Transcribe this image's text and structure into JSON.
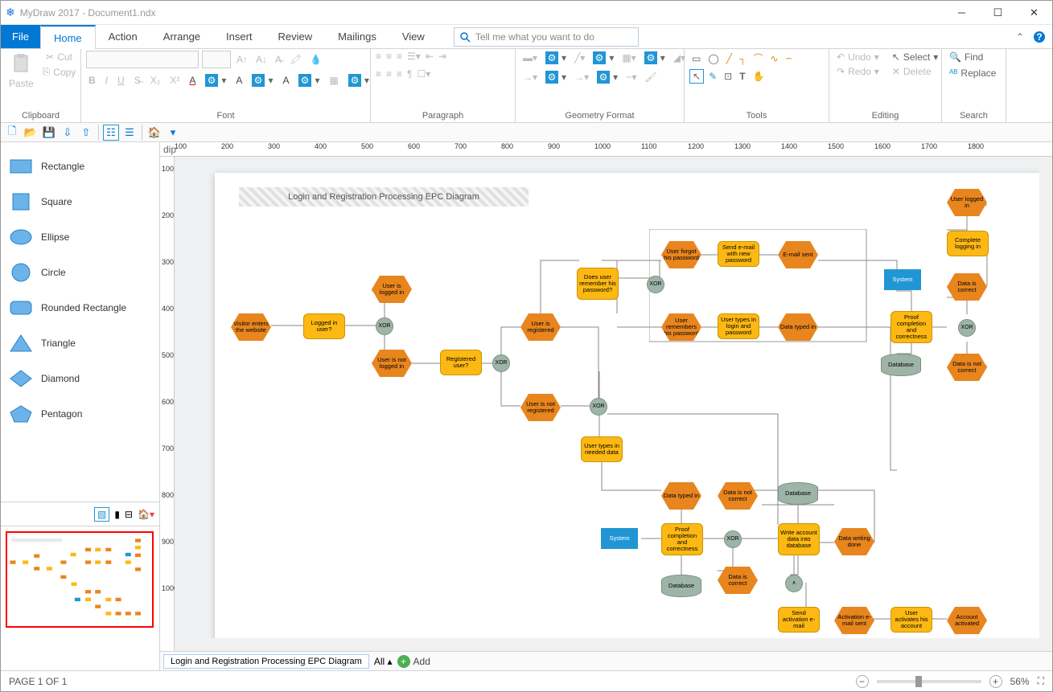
{
  "app": {
    "title": "MyDraw 2017 - Document1.ndx"
  },
  "tabs": {
    "file": "File",
    "home": "Home",
    "action": "Action",
    "arrange": "Arrange",
    "insert": "Insert",
    "review": "Review",
    "mailings": "Mailings",
    "view": "View"
  },
  "search": {
    "placeholder": "Tell me what you want to do"
  },
  "ribbon_groups": {
    "clipboard": "Clipboard",
    "font": "Font",
    "paragraph": "Paragraph",
    "geometry": "Geometry Format",
    "tools": "Tools",
    "editing": "Editing",
    "search": "Search"
  },
  "clipboard": {
    "paste": "Paste",
    "cut": "Cut",
    "copy": "Copy"
  },
  "editing": {
    "undo": "Undo",
    "redo": "Redo",
    "select": "Select",
    "delete": "Delete",
    "find": "Find",
    "replace": "Replace"
  },
  "shapes": {
    "rectangle": "Rectangle",
    "square": "Square",
    "ellipse": "Ellipse",
    "circle": "Circle",
    "rounded": "Rounded Rectangle",
    "triangle": "Triangle",
    "diamond": "Diamond",
    "pentagon": "Pentagon"
  },
  "ruler": {
    "unit": "dip",
    "hticks": [
      100,
      200,
      300,
      400,
      500,
      600,
      700,
      800,
      900,
      1000,
      1100,
      1200,
      1300,
      1400,
      1500,
      1600,
      1700,
      1800
    ],
    "vticks": [
      100,
      200,
      300,
      400,
      500,
      600,
      700,
      800,
      900,
      1000
    ]
  },
  "diagram": {
    "title": "Login and Registration Processing EPC Diagram"
  },
  "nodes": {
    "visitor": "Visitor enters the website",
    "logged_user": "Logged in user?",
    "user_logged": "User is logged in",
    "user_not_logged": "User is not logged in",
    "registered": "Registered user?",
    "user_registered": "User is registered",
    "user_not_registered": "User is not registered",
    "remember": "Does user remember his password?",
    "forgot": "User forgot his password",
    "send_mail": "Send e-mail with new password",
    "mail_sent": "E-mail sent",
    "remembers": "User remembers his password",
    "types_login": "User types in login and password",
    "data_typed": "Data typed in",
    "system": "System",
    "proof": "Proof completion and correctness",
    "db": "Database",
    "correct": "Data is correct",
    "incorrect": "Data is not correct",
    "complete": "Complete logging in",
    "logged_in": "User logged in",
    "types_data": "User types in needed data",
    "data_typed2": "Data typed in",
    "system2": "System",
    "proof2": "Proof completion and correctness",
    "db2": "Database",
    "db3": "Database",
    "correct2": "Data is correct",
    "incorrect2": "Data is not correct",
    "write": "Write account data into database",
    "writing_done": "Data writing done",
    "send_act": "Send activation e-mail",
    "act_sent": "Activation e-mail sent",
    "activates": "User activates his account",
    "activated": "Account activated",
    "xor": "XOR",
    "and": "∧"
  },
  "bottom_tabs": {
    "page1": "Login and Registration Processing EPC Diagram",
    "all": "All",
    "add": "Add"
  },
  "status": {
    "page": "PAGE 1 OF 1",
    "zoom": "56%"
  }
}
